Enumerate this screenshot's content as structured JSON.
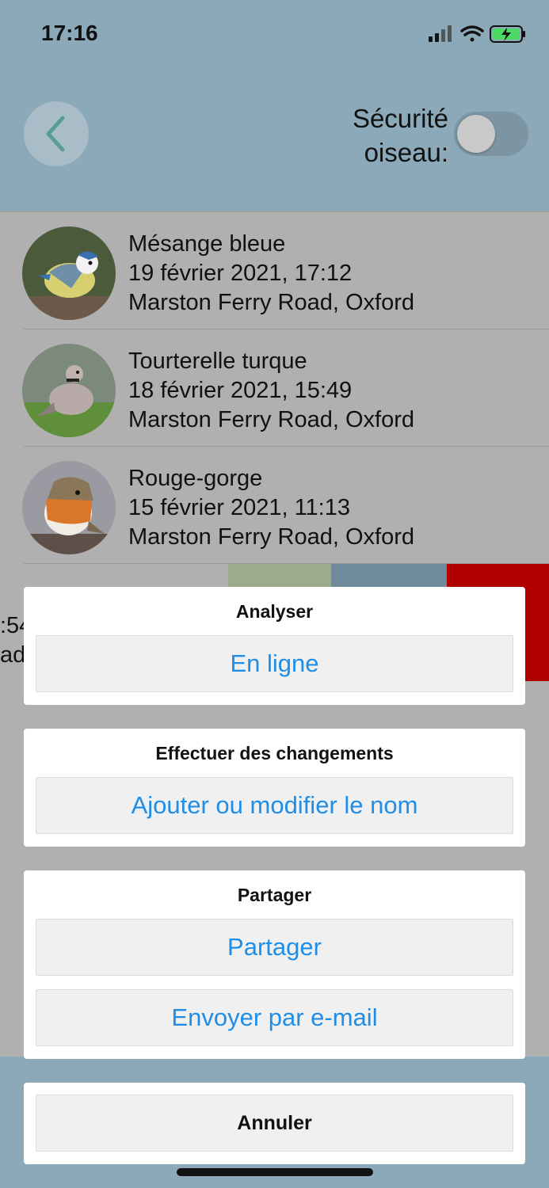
{
  "status_bar": {
    "time": "17:16"
  },
  "header": {
    "safety_label_line1": "Sécurité",
    "safety_label_line2": "oiseau:",
    "toggle_on": false
  },
  "sightings": [
    {
      "name": "Mésange bleue",
      "date": "19 février 2021, 17:12",
      "location": "Marston Ferry Road, Oxford"
    },
    {
      "name": "Tourterelle turque",
      "date": "18 février 2021, 15:49",
      "location": "Marston Ferry Road, Oxford"
    },
    {
      "name": "Rouge-gorge",
      "date": "15 février 2021, 11:13",
      "location": "Marston Ferry Road, Oxford"
    }
  ],
  "partial_row": {
    "line1": ":54",
    "line2": "ad"
  },
  "action_sheet": {
    "analyze": {
      "title": "Analyser",
      "online": "En ligne"
    },
    "changes": {
      "title": "Effectuer des changements",
      "edit_name": "Ajouter ou modifier le nom"
    },
    "share": {
      "title": "Partager",
      "share": "Partager",
      "email": "Envoyer par e-mail"
    },
    "cancel": "Annuler"
  },
  "colors": {
    "accent_blue": "#1f8ee8",
    "delete_red": "#b00000"
  }
}
